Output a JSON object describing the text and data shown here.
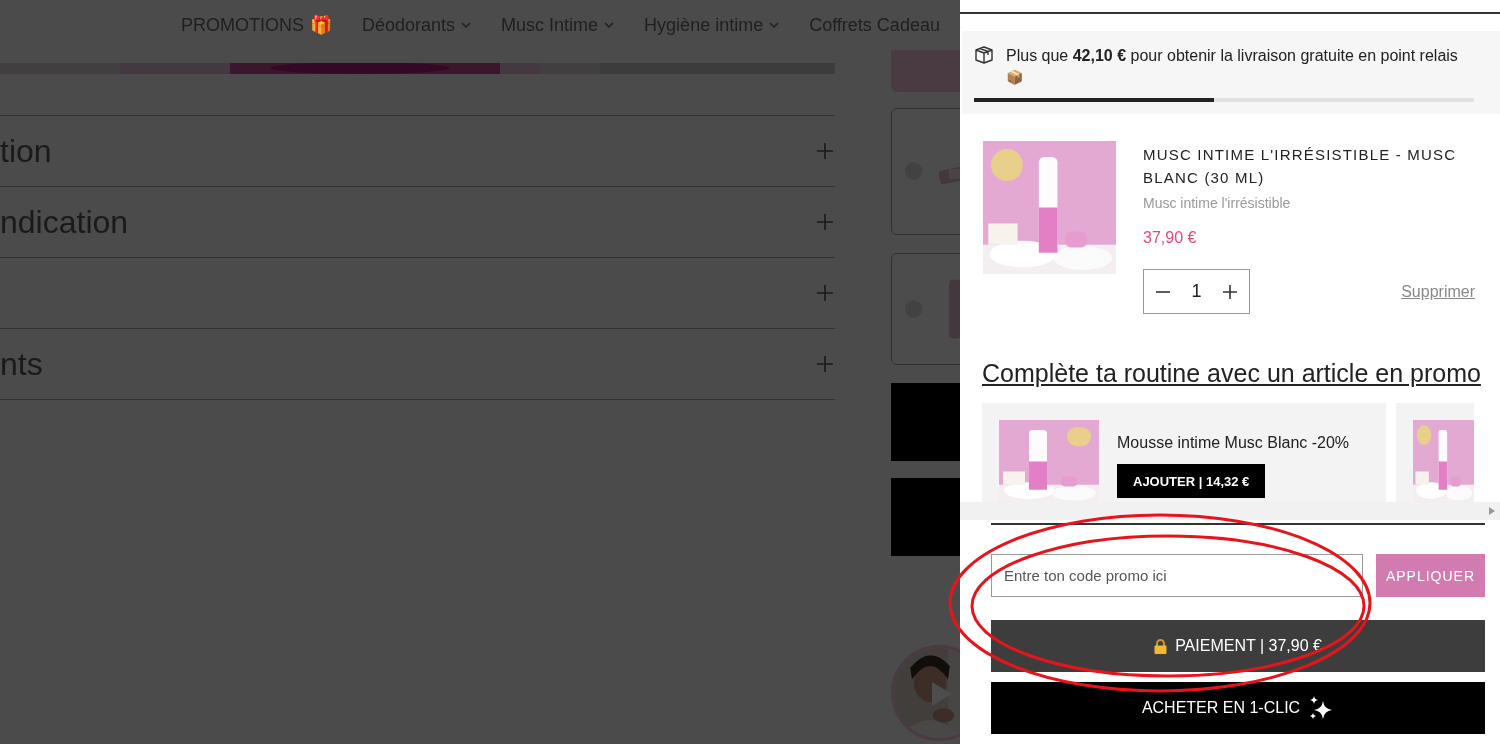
{
  "nav": {
    "items": [
      {
        "label": "PROMOTIONS",
        "emoji": "🎁",
        "has_menu": false
      },
      {
        "label": "Déodorants",
        "has_menu": true
      },
      {
        "label": "Musc Intime",
        "has_menu": true
      },
      {
        "label": "Hygiène intime",
        "has_menu": true
      },
      {
        "label": "Coffrets Cadeau",
        "has_menu": false
      }
    ]
  },
  "accordion": [
    {
      "title": "tion",
      "expanded": false
    },
    {
      "title": "ndication",
      "expanded": false
    },
    {
      "expanded": false
    },
    {
      "title": "nts",
      "expanded": false
    }
  ],
  "cart": {
    "shipping": {
      "message": "Plus que **42,10 €** pour obtenir la livraison gratuite en point relais",
      "emoji": "📦",
      "level": 0.48
    },
    "item": {
      "title": "MUSC INTIME L'IRRÉSISTIBLE - MUSC BLANC (30 ML)",
      "variant": "Musc intime l'irrésistible",
      "price": "37,90 €",
      "quantity": "1",
      "remove": "Supprimer"
    },
    "upsell": {
      "heading": "Complète ta routine avec un article en promo",
      "items": [
        {
          "kind": "offer",
          "name": "Mousse intime Musc Blanc -20%",
          "button": "AJOUTER | 14,32 €"
        },
        {
          "kind": "picture"
        }
      ]
    },
    "promo": {
      "placeholder": "Entre ton code promo ici",
      "button": "APPLIQUER",
      "disabled": true
    },
    "checkout": {
      "label": "PAIEMENT | 37,90 €"
    },
    "one_click": {
      "label": "ACHETER EN 1-CLIC"
    }
  },
  "markup": [
    {
      "kind": "ellipse"
    },
    {
      "kind": "ellipse"
    }
  ]
}
